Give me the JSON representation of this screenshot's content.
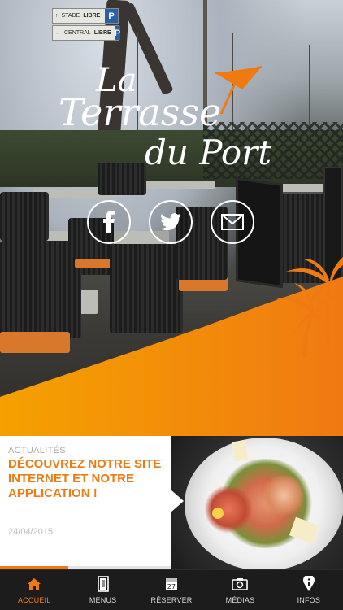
{
  "sign": {
    "row1_dest": "STADE",
    "row1_status": "LIBRE",
    "row2_dest": "CENTRAL",
    "row2_status": "LIBRE",
    "parking_letter": "P"
  },
  "logo": {
    "line1": "La",
    "line2": "Terrasse",
    "line3": "du Port",
    "accent_color": "#f07a12"
  },
  "social": [
    {
      "name": "facebook",
      "icon": "facebook-icon"
    },
    {
      "name": "twitter",
      "icon": "twitter-icon"
    },
    {
      "name": "email",
      "icon": "envelope-icon"
    }
  ],
  "news": {
    "kicker": "ACTUALITÉS",
    "title": "DÉCOUVREZ NOTRE SITE INTERNET ET NOTRE APPLICATION !",
    "date": "24/04/2015",
    "progress_fraction": 0.4,
    "arrow_icon": "share-arrow-icon"
  },
  "tabs": [
    {
      "label": "ACCUEIL",
      "icon": "home-icon",
      "active": true
    },
    {
      "label": "MENUS",
      "icon": "menu-book-icon",
      "active": false
    },
    {
      "label": "RÉSERVER",
      "icon": "calendar-icon",
      "active": false,
      "calendar_day": "27"
    },
    {
      "label": "MÉDIAS",
      "icon": "camera-icon",
      "active": false
    },
    {
      "label": "INFOS",
      "icon": "info-icon",
      "active": false
    }
  ],
  "colors": {
    "brand_orange": "#f07a12",
    "tab_bar_bg": "#1c1c1c",
    "tab_inactive": "#d8d8d8"
  }
}
